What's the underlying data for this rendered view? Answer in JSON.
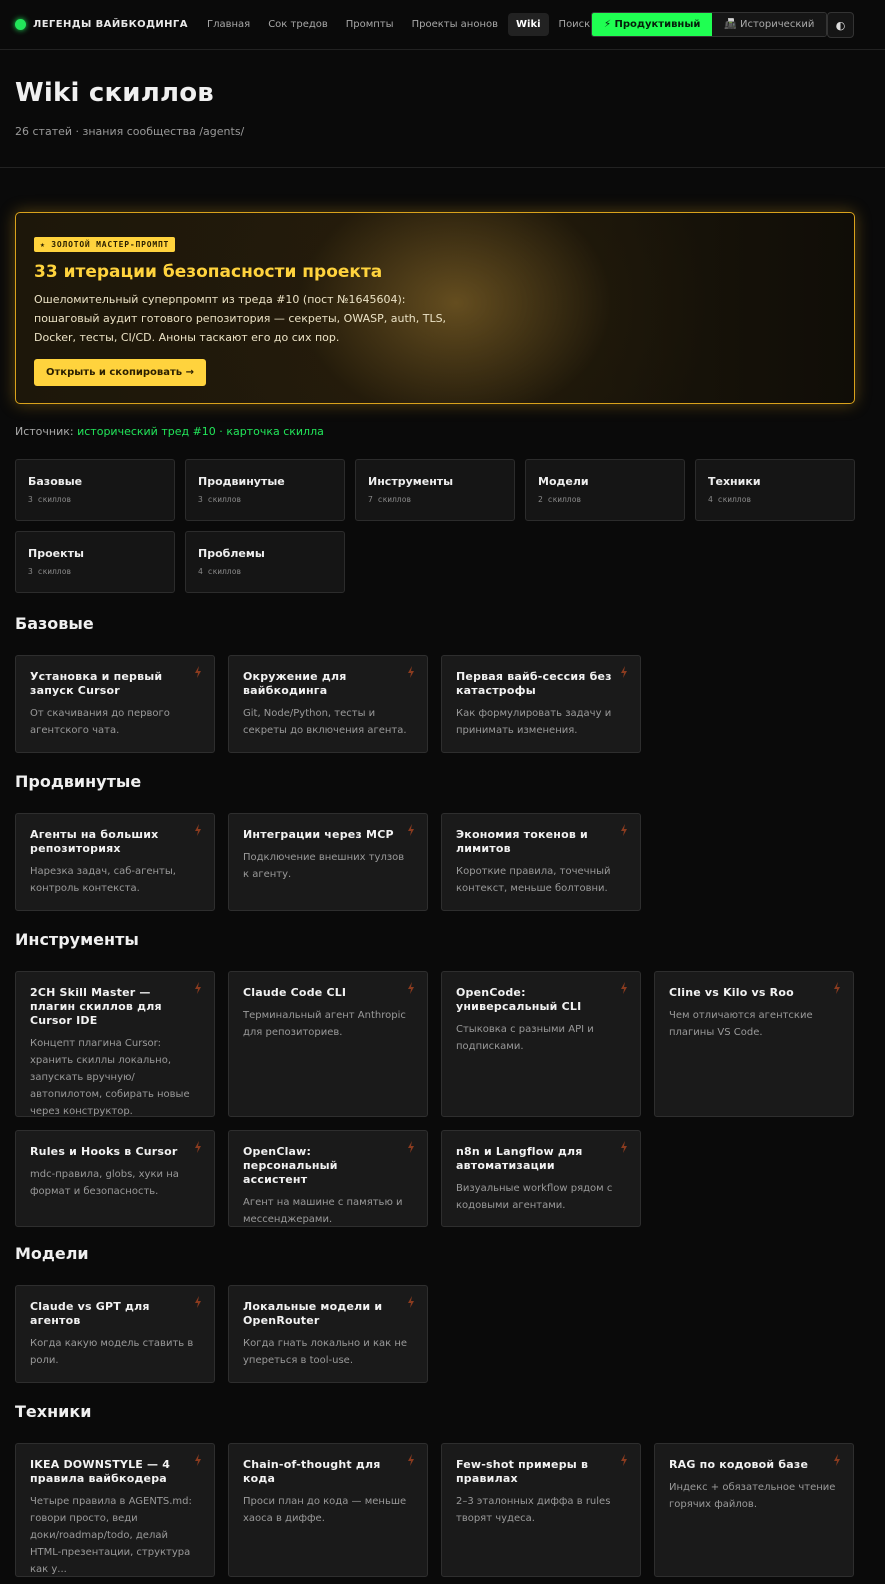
{
  "header": {
    "logo_text": "ЛЕГЕНДЫ ВАЙБКОДИНГА",
    "nav": [
      "Главная",
      "Сок тредов",
      "Промпты",
      "Проекты анонов",
      "Wiki",
      "Поиск"
    ],
    "active_nav": "Wiki",
    "mode_productive": "⚡ Продуктивный",
    "mode_historical": "📠 Исторический",
    "theme_icon": "◐",
    "colors": {
      "accent": "#1fff52",
      "gold": "#ffd33d",
      "bg": "#0a0a0a"
    }
  },
  "page": {
    "title": "Wiki скиллов",
    "subtitle": "26 статей · знания сообщества /agents/"
  },
  "hero": {
    "badge": "★ ЗОЛОТОЙ МАСТЕР-ПРОМПТ",
    "title": "33 итерации безопасности проекта",
    "description": "Ошеломительный суперпромпт из треда #10 (пост №1645604): пошаговый аудит готового репозитория — секреты, OWASP, auth, TLS, Docker, тесты, CI/CD. Аноны таскают его до сих пор.",
    "button": "Открыть и скопировать →"
  },
  "source": {
    "label": "Источник:",
    "link1": "исторический тред #10",
    "separator": " · ",
    "link2": "карточка скилла"
  },
  "categories": [
    {
      "name": "Базовые",
      "count": "3 скиллов"
    },
    {
      "name": "Продвинутые",
      "count": "3 скиллов"
    },
    {
      "name": "Инструменты",
      "count": "7 скиллов"
    },
    {
      "name": "Модели",
      "count": "2 скиллов"
    },
    {
      "name": "Техники",
      "count": "4 скиллов"
    },
    {
      "name": "Проекты",
      "count": "3 скиллов"
    },
    {
      "name": "Проблемы",
      "count": "4 скиллов"
    }
  ],
  "sections": {
    "basic": {
      "title": "Базовые",
      "cards": [
        {
          "title": "Установка и первый запуск Cursor",
          "desc": "От скачивания до первого агентского чата."
        },
        {
          "title": "Окружение для вайбкодинга",
          "desc": "Git, Node/Python, тесты и секреты до включения агента."
        },
        {
          "title": "Первая вайб-сессия без катастрофы",
          "desc": "Как формулировать задачу и принимать изменения."
        }
      ]
    },
    "advanced": {
      "title": "Продвинутые",
      "cards": [
        {
          "title": "Агенты на больших репозиториях",
          "desc": "Нарезка задач, саб-агенты, контроль контекста."
        },
        {
          "title": "Интеграции через MCP",
          "desc": "Подключение внешних тулзов к агенту."
        },
        {
          "title": "Экономия токенов и лимитов",
          "desc": "Короткие правила, точечный контекст, меньше болтовни."
        }
      ]
    },
    "tools": {
      "title": "Инструменты",
      "cards": [
        {
          "title": "2CH Skill Master — плагин скиллов для Cursor IDE",
          "desc": "Концепт плагина Cursor: хранить скиллы локально, запускать вручную/автопилотом, собирать новые через конструктор."
        },
        {
          "title": "Claude Code CLI",
          "desc": "Терминальный агент Anthropic для репозиториев."
        },
        {
          "title": "OpenCode: универсальный CLI",
          "desc": "Стыковка с разными API и подписками."
        },
        {
          "title": "Cline vs Kilo vs Roo",
          "desc": "Чем отличаются агентские плагины VS Code."
        },
        {
          "title": "Rules и Hooks в Cursor",
          "desc": "mdc-правила, globs, хуки на формат и безопасность."
        },
        {
          "title": "OpenClaw: персональный ассистент",
          "desc": "Агент на машине с памятью и мессенджерами."
        },
        {
          "title": "n8n и Langflow для автоматизации",
          "desc": "Визуальные workflow рядом с кодовыми агентами."
        }
      ]
    },
    "models": {
      "title": "Модели",
      "cards": [
        {
          "title": "Claude vs GPT для агентов",
          "desc": "Когда какую модель ставить в роли."
        },
        {
          "title": "Локальные модели и OpenRouter",
          "desc": "Когда гнать локально и как не упереться в tool-use."
        }
      ]
    },
    "techniques": {
      "title": "Техники",
      "cards": [
        {
          "title": "IKEA DOWNSTYLE — 4 правила вайбкодера",
          "desc": "Четыре правила в AGENTS.md: говори просто, веди доки/roadmap/todo, делай HTML-презентации, структура как у..."
        },
        {
          "title": "Chain-of-thought для кода",
          "desc": "Проси план до кода — меньше хаоса в диффе."
        },
        {
          "title": "Few-shot примеры в правилах",
          "desc": "2–3 эталонных диффа в rules творят чудеса."
        },
        {
          "title": "RAG по кодовой базе",
          "desc": "Индекс + обязательное чтение горячих файлов."
        }
      ]
    }
  }
}
